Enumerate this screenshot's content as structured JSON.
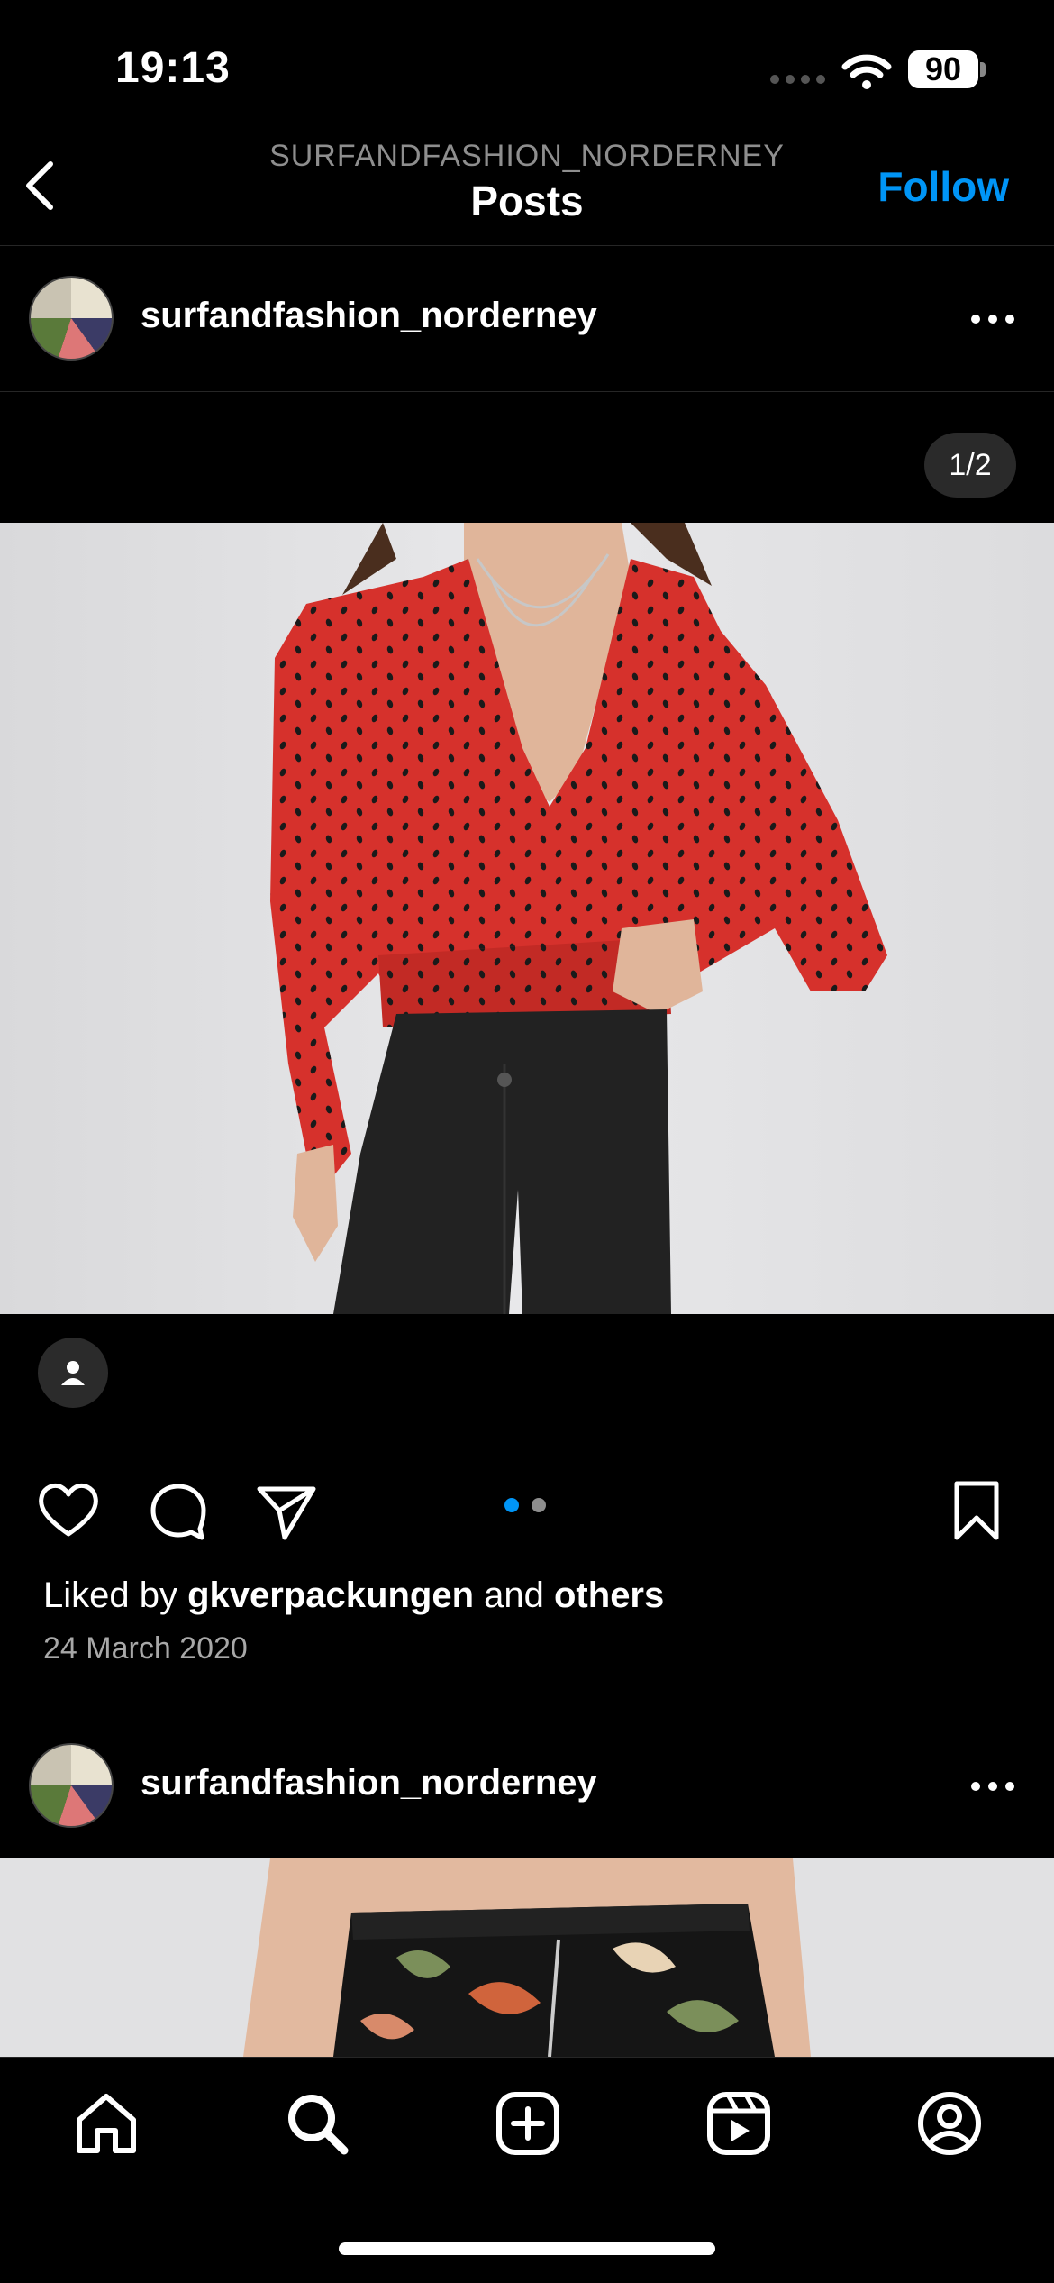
{
  "status_bar": {
    "time": "19:13",
    "battery": "90"
  },
  "header": {
    "account": "SURFANDFASHION_NORDERNEY",
    "title": "Posts",
    "follow_label": "Follow"
  },
  "post1": {
    "username": "surfandfashion_norderney",
    "counter": "1/2",
    "liked_prefix": "Liked by",
    "liked_user": "gkverpackungen",
    "liked_and": "and",
    "liked_others": "others",
    "date": "24 March 2020",
    "carousel": {
      "count": 2,
      "active": 0
    }
  },
  "post2": {
    "username": "surfandfashion_norderney"
  },
  "icons": {
    "back": "chevron-left-icon",
    "more": "more-horizontal-icon",
    "tag": "person-tag-icon",
    "like": "heart-icon",
    "comment": "comment-icon",
    "share": "send-icon",
    "save": "bookmark-icon",
    "tabs": [
      "home-icon",
      "search-icon",
      "create-icon",
      "reels-icon",
      "profile-icon"
    ]
  },
  "colors": {
    "accent": "#0095f6",
    "background": "#000000",
    "dot_inactive": "#8e8e8e",
    "shirt": "#d6312c"
  }
}
